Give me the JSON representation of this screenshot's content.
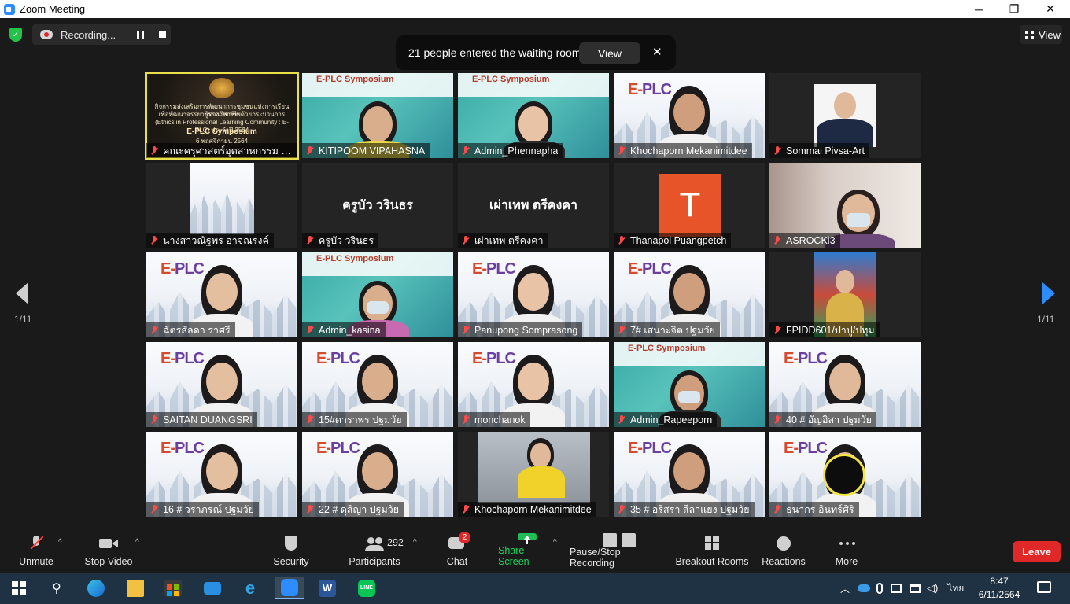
{
  "window": {
    "title": "Zoom Meeting",
    "minimize": "─",
    "maximize": "❐",
    "close": "✕"
  },
  "top": {
    "recording_label": "Recording...",
    "notification_text": "21 people entered the waiting room",
    "notification_button": "View",
    "notification_close": "✕",
    "view_label": "View"
  },
  "pager": {
    "left_count": "1/11",
    "right_count": "1/11"
  },
  "tiles": [
    {
      "name": "คณะครุศาสตร์อุตสาหกรรม มหาร...",
      "style": "slide",
      "active": true
    },
    {
      "name": "KITIPOOM VIPAHASNA",
      "style": "teal"
    },
    {
      "name": "Admin_Phennapha",
      "style": "teal"
    },
    {
      "name": "Khochaporn Mekanimitdee",
      "style": "city"
    },
    {
      "name": "Sommai Pivsa-Art",
      "style": "photo"
    },
    {
      "name": "นางสาวณัฐพร อาจณรงค์",
      "style": "small-city"
    },
    {
      "name": "ครูบัว วรินธร",
      "style": "namecard",
      "display": "ครูบัว วรินธร"
    },
    {
      "name": "เผ่าเทพ ตรีคงคา",
      "style": "namecard",
      "display": "เผ่าเทพ  ตรีคงคา"
    },
    {
      "name": "Thanapol Puangpetch",
      "style": "avatar",
      "initial": "T"
    },
    {
      "name": "ASROCKi3",
      "style": "room"
    },
    {
      "name": "ฉัตรสัลดา ราศรี",
      "style": "city"
    },
    {
      "name": "Admin_kasina",
      "style": "teal"
    },
    {
      "name": "Panupong Somprasong",
      "style": "city"
    },
    {
      "name": "7# เสนาะจิต ปฐมวัย",
      "style": "city"
    },
    {
      "name": "FPIDD601/ปาปู/ปทุม",
      "style": "costume"
    },
    {
      "name": "SAITAN DUANGSRI",
      "style": "city"
    },
    {
      "name": "15#ดาราพร ปฐมวัย",
      "style": "city"
    },
    {
      "name": "monchanok",
      "style": "city"
    },
    {
      "name": "Admin_Rapeeporn",
      "style": "teal"
    },
    {
      "name": "40 # อัญอิสา ปฐมวัย",
      "style": "city"
    },
    {
      "name": "16 # วราภรณ์ ปฐมวัย",
      "style": "city"
    },
    {
      "name": "22 # ดุสิญา  ปฐมวัย",
      "style": "city"
    },
    {
      "name": "Khochaporn Mekanimitdee",
      "style": "office"
    },
    {
      "name": "35 # อริสรา สีลาแยง ปฐมวัย",
      "style": "city"
    },
    {
      "name": "ธนากร อินทร์ศิริ",
      "style": "city"
    }
  ],
  "slide": {
    "line1": "กิจกรรมส่งเสริมการพัฒนาการชุมชนแห่งการเรียนรู้ทางวิชาชีพ",
    "line2": "เพื่อพัฒนาจรรยาบรรณวิชาชีพด้วยกระบวนการ",
    "line3": "(Ethics in Professional Learning Community : E-PLC) ประจำปี 2564",
    "line4": "E-PLC Symposium",
    "line5": "6 พฤศจิกายน 2564"
  },
  "teal_banner": "E-PLC Symposium",
  "city_logo": {
    "e": "E-",
    "plc": "PLC"
  },
  "toolbar": {
    "unmute": "Unmute",
    "stop_video": "Stop Video",
    "security": "Security",
    "participants": "Participants",
    "participants_count": "292",
    "chat": "Chat",
    "chat_badge": "2",
    "share_screen": "Share Screen",
    "recording": "Pause/Stop Recording",
    "breakout": "Breakout Rooms",
    "reactions": "Reactions",
    "more": "More",
    "leave": "Leave"
  },
  "taskbar": {
    "language": "ไทย",
    "time": "8:47",
    "date": "6/11/2564"
  },
  "colors": {
    "accent": "#2d8cff",
    "leave": "#e02828",
    "share": "#1fbd57",
    "active_speaker": "#eae14a"
  }
}
